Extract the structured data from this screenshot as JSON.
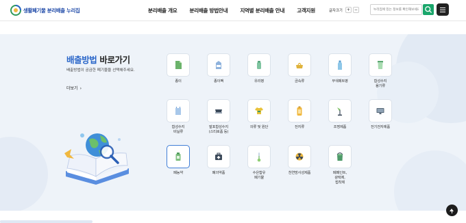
{
  "header": {
    "logo_text": "생활폐기물 분리배출 누리집",
    "nav": [
      "분리배출 개요",
      "분리배출 방법안내",
      "지역별 분리배출 안내",
      "고객지원"
    ],
    "font_size_label": "글자크기",
    "font_plus": "+",
    "font_minus": "−",
    "search_placeholder": "누리집에 있는 정보를 확인해보세요."
  },
  "section": {
    "title_highlight": "배출방법",
    "title_rest": " 바로가기",
    "description": "배출방법이 궁금한 폐기물을 선택해주세요.",
    "more_label": "더보기",
    "more_arrow": "›"
  },
  "categories": [
    {
      "label": "종이",
      "icon": "paper-icon",
      "color": "#6bb36b"
    },
    {
      "label": "종이팩",
      "icon": "paper-pack-icon",
      "color": "#8fb3dd"
    },
    {
      "label": "유리병",
      "icon": "glass-bottle-icon",
      "color": "#7fc4a0"
    },
    {
      "label": "금속류",
      "icon": "metal-can-icon",
      "color": "#e0b33c"
    },
    {
      "label": "무색페트병",
      "icon": "pet-bottle-icon",
      "color": "#8ec7e8"
    },
    {
      "label": "합성수지\n용기류",
      "icon": "plastic-container-icon",
      "color": "#78c08a"
    },
    {
      "label": "합성수지\n비닐류",
      "icon": "vinyl-icon",
      "color": "#a8c8ea"
    },
    {
      "label": "발포합성수지\n(스티로폼 등)",
      "icon": "styrofoam-icon",
      "color": "#3c4a5a"
    },
    {
      "label": "의류 및 원단",
      "icon": "clothes-icon",
      "color": "#e9c23a"
    },
    {
      "label": "전지류",
      "icon": "battery-icon",
      "color": "#f0b840"
    },
    {
      "label": "조명제품",
      "icon": "lamp-icon",
      "color": "#7cbf64"
    },
    {
      "label": "전기전자제품",
      "icon": "monitor-icon",
      "color": "#5a6a7a"
    },
    {
      "label": "폐농약",
      "icon": "pesticide-icon",
      "color": "#7fc080"
    },
    {
      "label": "폐의약품",
      "icon": "medicine-icon",
      "color": "#3c4a5a"
    },
    {
      "label": "수은함유\n폐기물",
      "icon": "thermometer-icon",
      "color": "#8fce74"
    },
    {
      "label": "천연방사성제품",
      "icon": "radiation-icon",
      "color": "#e9b43c"
    },
    {
      "label": "폐페인트,\n광택제,\n접착제",
      "icon": "paint-can-icon",
      "color": "#4f9a6a"
    }
  ],
  "selected_category": "폐농약"
}
